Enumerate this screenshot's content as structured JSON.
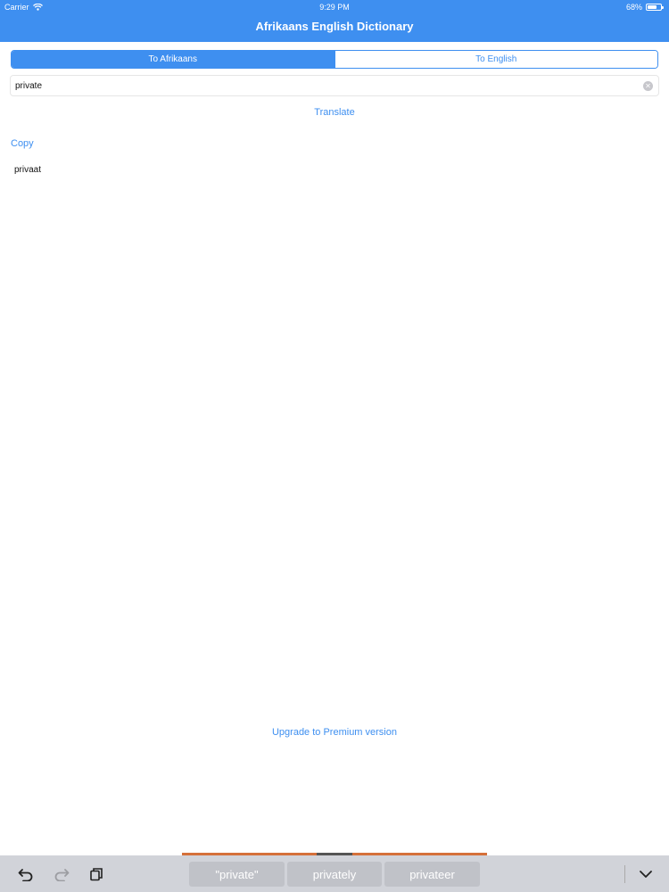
{
  "status_bar": {
    "carrier": "Carrier",
    "time": "9:29 PM",
    "battery": "68%",
    "battery_level": 0.68
  },
  "header": {
    "title": "Afrikaans English Dictionary"
  },
  "segmented_control": {
    "options": [
      {
        "label": "To Afrikaans",
        "selected": true
      },
      {
        "label": "To English",
        "selected": false
      }
    ]
  },
  "search": {
    "value": "private"
  },
  "actions": {
    "translate_label": "Translate",
    "copy_label": "Copy",
    "upgrade_label": "Upgrade to Premium version"
  },
  "result": {
    "text": "privaat"
  },
  "keyboard": {
    "suggestions": [
      "\"private\"",
      "privately",
      "privateer"
    ],
    "icons": [
      "undo-icon",
      "redo-icon",
      "paste-icon",
      "dismiss-keyboard-icon"
    ]
  },
  "colors": {
    "accent": "#3e8ff0",
    "keyboard_bar": "#d1d3d9",
    "suggestion_bg": "#c0c2c8"
  }
}
